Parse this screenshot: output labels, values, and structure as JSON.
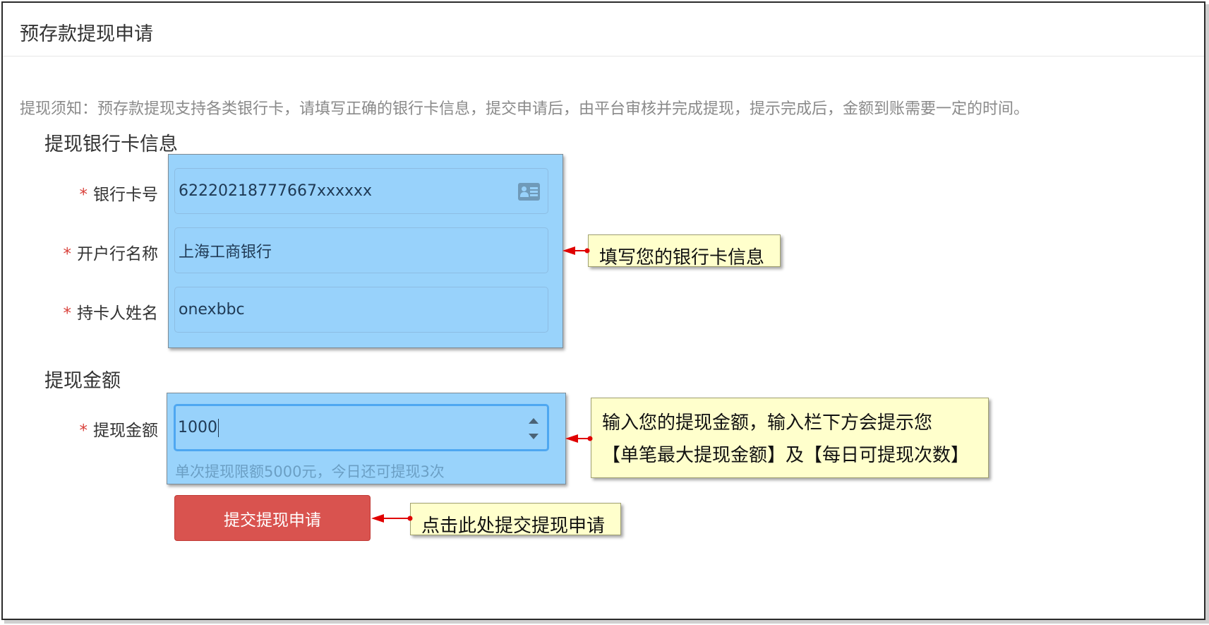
{
  "page": {
    "title": "预存款提现申请"
  },
  "notice": "提现须知：预存款提现支持各类银行卡，请填写正确的银行卡信息，提交申请后，由平台审核并完成提现，提示完成后，金额到账需要一定的时间。",
  "bank_section": {
    "title": "提现银行卡信息",
    "required_mark": "*",
    "fields": [
      {
        "label": "银行卡号",
        "value": "62220218777667xxxxxx"
      },
      {
        "label": "开户行名称",
        "value": "上海工商银行"
      },
      {
        "label": "持卡人姓名",
        "value": "onexbbc"
      }
    ]
  },
  "amount_section": {
    "title": "提现金额",
    "required_mark": "*",
    "label": "提现金额",
    "value": "1000",
    "hint": "单次提现限额5000元，今日还可提现3次"
  },
  "submit_button": "提交提现申请",
  "callouts": {
    "bank_info": "填写您的银行卡信息",
    "amount_line1": "输入您的提现金额，输入栏下方会提示您",
    "amount_line2": "【单笔最大提现金额】及【每日可提现次数】",
    "submit": "点击此处提交提现申请"
  },
  "colors": {
    "highlight": "#99d3fb",
    "required": "#d9403a",
    "submit_button": "#d9534f",
    "callout_bg": "#ffffcc",
    "arrow": "#e00000"
  },
  "icons": {
    "bank_card_field": "id-card-icon",
    "amount_field": "number-spinner-icon"
  }
}
